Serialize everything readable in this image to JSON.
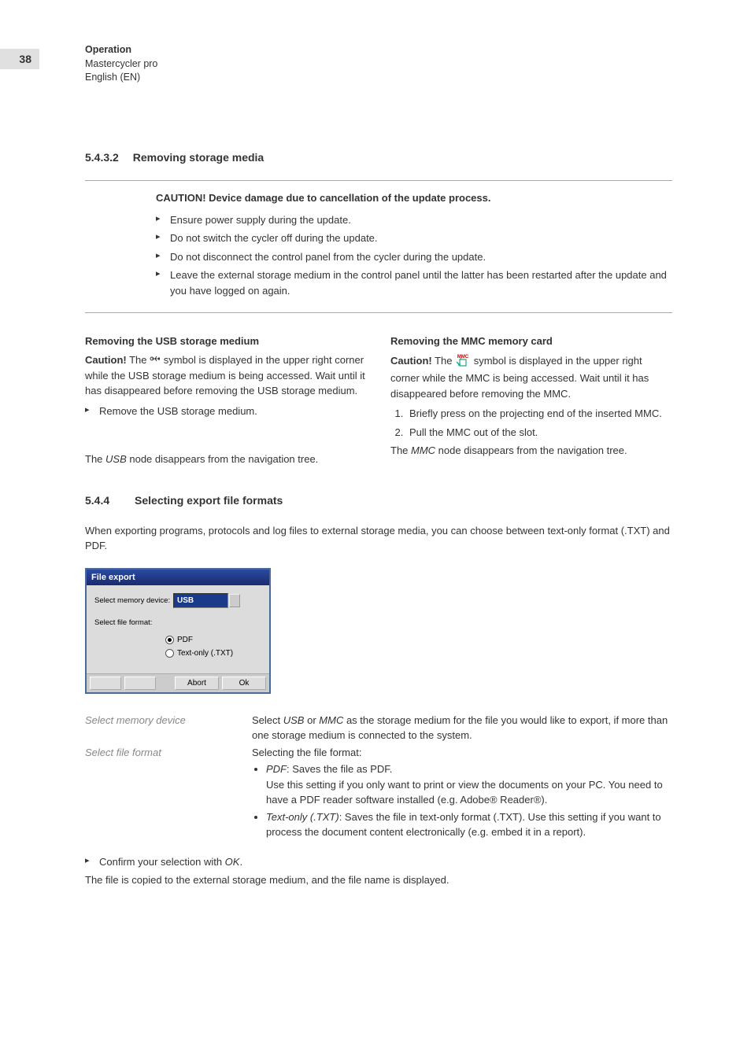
{
  "page_number": "38",
  "header": {
    "line1": "Operation",
    "line2": "Mastercycler pro",
    "line3": "English (EN)"
  },
  "section_5432": {
    "number": "5.4.3.2",
    "title": "Removing storage media"
  },
  "caution_box": {
    "title": "CAUTION! Device damage due to cancellation of the update process.",
    "items": [
      "Ensure power supply during the update.",
      "Do not switch the cycler off during the update.",
      "Do not disconnect the control panel from the cycler during the update.",
      "Leave the external storage medium in the control panel until the latter has been restarted after the update and you have logged on again."
    ]
  },
  "usb_col": {
    "title": "Removing the USB storage medium",
    "caution_pre": "Caution!",
    "caution_mid1": " The ",
    "caution_mid2": " symbol is displayed in the upper right corner while the USB storage medium is being accessed. Wait until it has disappeared before removing the USB storage medium.",
    "step": "Remove the USB storage medium.",
    "result_pre": "The ",
    "result_italic": "USB",
    "result_post": " node disappears from the navigation tree."
  },
  "mmc_col": {
    "title": "Removing the MMC memory card",
    "caution_pre": "Caution!",
    "caution_mid1": " The ",
    "caution_mid2": " symbol is displayed in the upper right corner while the MMC is being accessed. Wait until it has disappeared before removing the MMC.",
    "steps": [
      "Briefly press on the projecting end of the inserted MMC.",
      "Pull the MMC out of the slot."
    ],
    "result_pre": "The ",
    "result_italic": "MMC",
    "result_post": " node disappears from the navigation tree."
  },
  "section_544": {
    "number": "5.4.4",
    "title": "Selecting export file formats",
    "intro": "When exporting programs, protocols and log files to external storage media, you can choose between text-only format (.TXT) and PDF."
  },
  "dialog": {
    "title": "File export",
    "label_device": "Select memory device:",
    "select_value": "USB",
    "label_format": "Select file format:",
    "radio_pdf": "PDF",
    "radio_txt": "Text-only (.TXT)",
    "btn_abort": "Abort",
    "btn_ok": "Ok"
  },
  "defs": {
    "row1_term": "Select memory device",
    "row1_body_pre": "Select ",
    "row1_body_i1": "USB",
    "row1_body_mid": " or ",
    "row1_body_i2": "MMC",
    "row1_body_post": " as the storage medium for the file you would like to export, if more than one storage medium is connected to the system.",
    "row2_term": "Select file format",
    "row2_intro": "Selecting the file format:",
    "row2_b1_i": "PDF",
    "row2_b1_rest": ": Saves the file as PDF.",
    "row2_b1_desc": "Use this setting if you only want to print or view the documents on your PC. You need to have a PDF reader software installed (e.g. Adobe® Reader®).",
    "row2_b2_i": "Text-only (.TXT)",
    "row2_b2_rest": ": Saves the file in text-only format (.TXT). Use this setting if you want to process the document content electronically (e.g. embed it in a report)."
  },
  "final": {
    "confirm_pre": "Confirm your selection with ",
    "confirm_i": "OK",
    "confirm_post": ".",
    "copied": "The file is copied to the external storage medium, and the file name is displayed."
  }
}
